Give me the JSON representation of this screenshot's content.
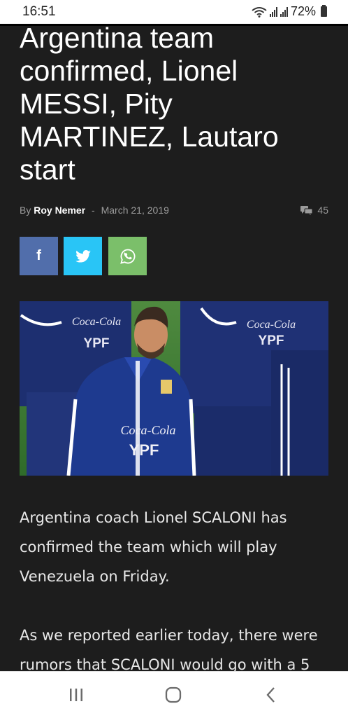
{
  "status_bar": {
    "time": "16:51",
    "battery": "72%"
  },
  "article": {
    "title": "Argentina team confirmed, Lionel MESSI, Pity MARTINEZ, Lautaro start",
    "by_label": "By",
    "author": "Roy Nemer",
    "separator": "-",
    "date": "March 21, 2019",
    "comments": "45",
    "paragraphs": [
      "Argentina coach Lionel SCALONI has confirmed the team which will play Venezuela on Friday.",
      "As we reported earlier today, there were rumors that SCALONI would go with a 5"
    ]
  },
  "share": {
    "facebook_label": "f",
    "facebook_color": "#516eab",
    "twitter_color": "#29c5f6",
    "whatsapp_color": "#7bbf6a"
  },
  "photo": {
    "jersey_sponsor": "Coca-Cola",
    "jersey_text": "YPF"
  },
  "nav": {
    "icons": [
      "recent-apps-icon",
      "home-icon",
      "back-icon"
    ]
  }
}
